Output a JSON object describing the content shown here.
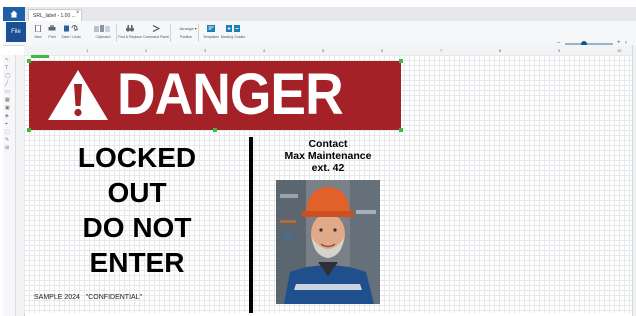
{
  "window": {
    "tab_label": "SRL_label - 1.00 ...",
    "tab_close": "×"
  },
  "ribbon": {
    "file_label": "File",
    "buttons": [
      {
        "label": "New"
      },
      {
        "label": "Print"
      },
      {
        "label": "Save / Undo"
      },
      {
        "label": "Clipboard"
      },
      {
        "label": "Find & Replace"
      },
      {
        "label": "Command Panel"
      },
      {
        "label": "Arrange"
      },
      {
        "label": "Position"
      },
      {
        "label": "Templates"
      },
      {
        "label": "Marking Guides"
      }
    ],
    "arrange_dropdown": "Arrange ▾"
  },
  "zoom": {
    "minus": "–",
    "plus": "+",
    "level": 0.4
  },
  "ruler": {
    "ticks": [
      "1",
      "2",
      "3",
      "4",
      "5",
      "6",
      "7",
      "8",
      "9",
      "10"
    ]
  },
  "tools": [
    "↖",
    "T",
    "◯",
    "╱",
    "▭",
    "▦",
    "▣",
    "◈",
    "⌖",
    "⬚",
    "✎",
    "⊞"
  ],
  "label": {
    "banner_word": "DANGER",
    "banner_color": "#a42128",
    "lockout_lines": [
      "LOCKED",
      "OUT",
      "DO NOT",
      "ENTER"
    ],
    "contact_lines": [
      "Contact",
      "Max Maintenance",
      "ext. 42"
    ],
    "footer": "SAMPLE 2024   \"CONFIDENTIAL\""
  }
}
